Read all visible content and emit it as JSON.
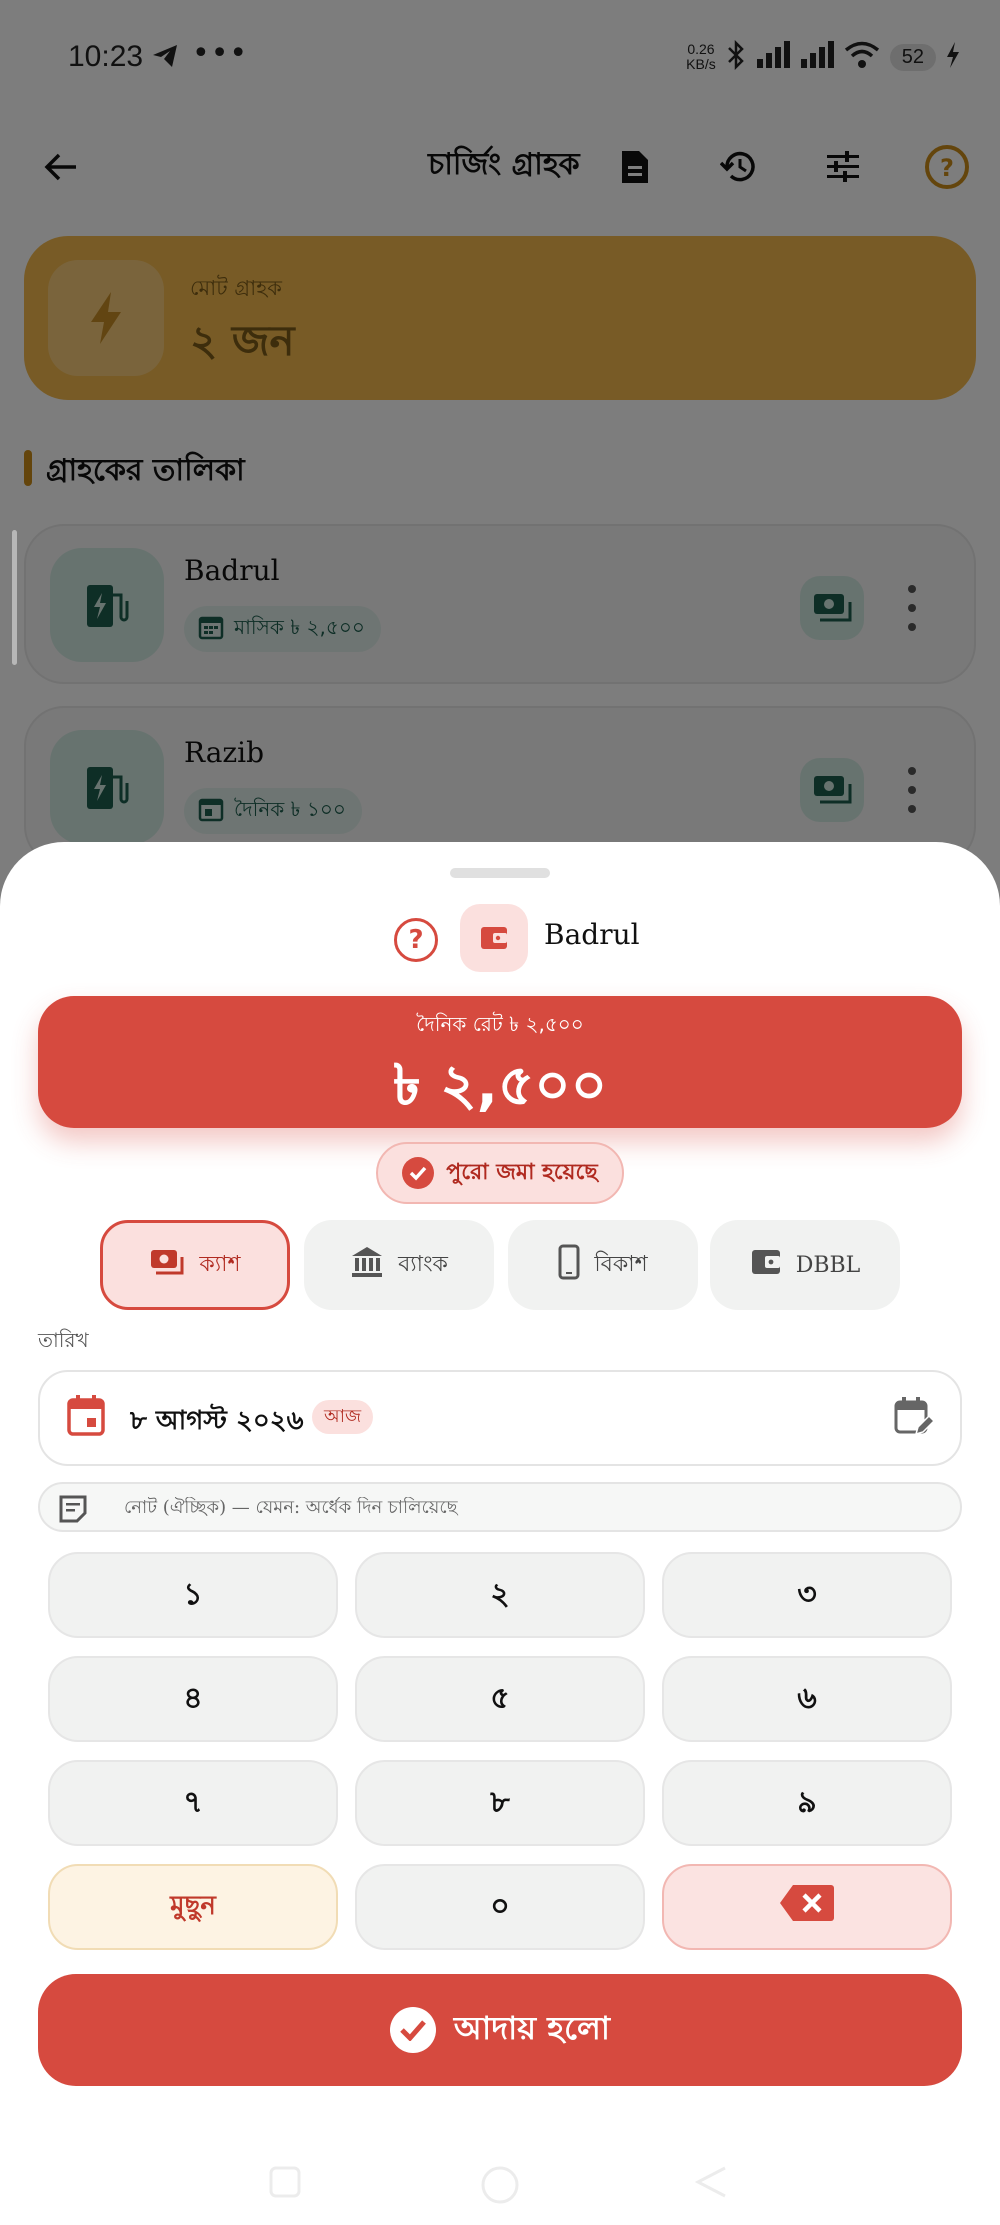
{
  "status": {
    "time": "10:23",
    "more": "•••",
    "net_speed_value": "0.26",
    "net_speed_unit": "KB/s",
    "battery": "52",
    "icons": [
      "telegram-icon",
      "bluetooth-icon",
      "signal-icon",
      "signal-icon",
      "wifi-icon",
      "battery-icon",
      "charging-icon"
    ]
  },
  "appbar": {
    "title": "চার্জিং গ্রাহক",
    "icons": [
      "back-arrow-icon",
      "document-icon",
      "history-icon",
      "settings-sliders-icon",
      "help-icon"
    ]
  },
  "summary": {
    "label": "মোট গ্রাহক",
    "value": "২ জন",
    "icon": "bolt-icon"
  },
  "section_title": "গ্রাহকের তালিকা",
  "customers": [
    {
      "name": "Badrul",
      "plan": "মাসিক ৳ ২,৫০০",
      "plan_icon": "calendar-month-icon"
    },
    {
      "name": "Razib",
      "plan": "দৈনিক ৳ ১০০",
      "plan_icon": "calendar-day-icon"
    }
  ],
  "sheet": {
    "customer_name": "Badrul",
    "rate_label": "দৈনিক রেট ৳ ২,৫০০",
    "amount": "৳ ২,৫০০",
    "paid_status": "পুরো জমা হয়েছে",
    "methods": [
      {
        "label": "ক্যাশ",
        "icon": "cash-icon",
        "selected": true
      },
      {
        "label": "ব্যাংক",
        "icon": "bank-icon",
        "selected": false
      },
      {
        "label": "বিকাশ",
        "icon": "phone-icon",
        "selected": false
      },
      {
        "label": "DBBL",
        "icon": "wallet-icon",
        "selected": false
      }
    ],
    "date_label": "তারিখ",
    "date_value": "৮ আগস্ট ২০২৬",
    "today_badge": "আজ",
    "note_placeholder": "নোট (ঐচ্ছিক) — যেমন: অর্ধেক দিন চালিয়েছে",
    "keypad": {
      "keys": [
        "১",
        "২",
        "৩",
        "৪",
        "৫",
        "৬",
        "৭",
        "৮",
        "৯"
      ],
      "clear": "মুছুন",
      "zero": "০",
      "backspace_icon": "backspace-icon"
    },
    "submit": "আদায় হলো"
  },
  "colors": {
    "accent_red": "#d64a3f",
    "summary_amber": "#f0b64c",
    "teal": "#1d5c4d"
  }
}
